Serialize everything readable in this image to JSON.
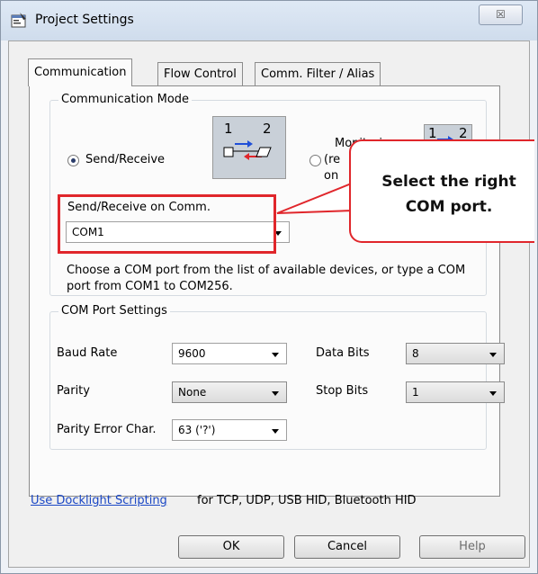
{
  "window": {
    "title": "Project Settings",
    "close_glyph": "☒"
  },
  "tabs": [
    {
      "label": "Communication",
      "active": true
    },
    {
      "label": "Flow Control",
      "active": false
    },
    {
      "label": "Comm. Filter / Alias",
      "active": false
    }
  ],
  "communication_mode": {
    "title": "Communication Mode",
    "send_receive": {
      "label": "Send/Receive",
      "selected": true
    },
    "monitoring": {
      "label_line1": "Monitoring",
      "label_line2": "(re",
      "label_line3": "on",
      "selected": false
    },
    "diagram_1": "1",
    "diagram_2": "2",
    "mon_diagram_1": "1",
    "mon_diagram_2": "2"
  },
  "send_receive_comm": {
    "label": "Send/Receive on Comm.",
    "value": "COM1",
    "help": "Choose a COM port from the list of available devices, or type a COM port from COM1 to COM256."
  },
  "com_port_settings": {
    "title": "COM Port Settings",
    "baud_rate": {
      "label": "Baud Rate",
      "value": "9600"
    },
    "data_bits": {
      "label": "Data Bits",
      "value": "8"
    },
    "parity": {
      "label": "Parity",
      "value": "None"
    },
    "stop_bits": {
      "label": "Stop Bits",
      "value": "1"
    },
    "parity_error_char": {
      "label": "Parity Error Char.",
      "value": "63 ('?')"
    }
  },
  "scripting": {
    "link": "Use Docklight Scripting",
    "text": "for TCP, UDP, USB HID, Bluetooth HID"
  },
  "buttons": {
    "ok": "OK",
    "cancel": "Cancel",
    "help": "Help"
  },
  "callout": {
    "line1": "Select the right",
    "line2": "COM port."
  },
  "colors": {
    "highlight": "#e0262b",
    "link": "#1a47c5"
  }
}
